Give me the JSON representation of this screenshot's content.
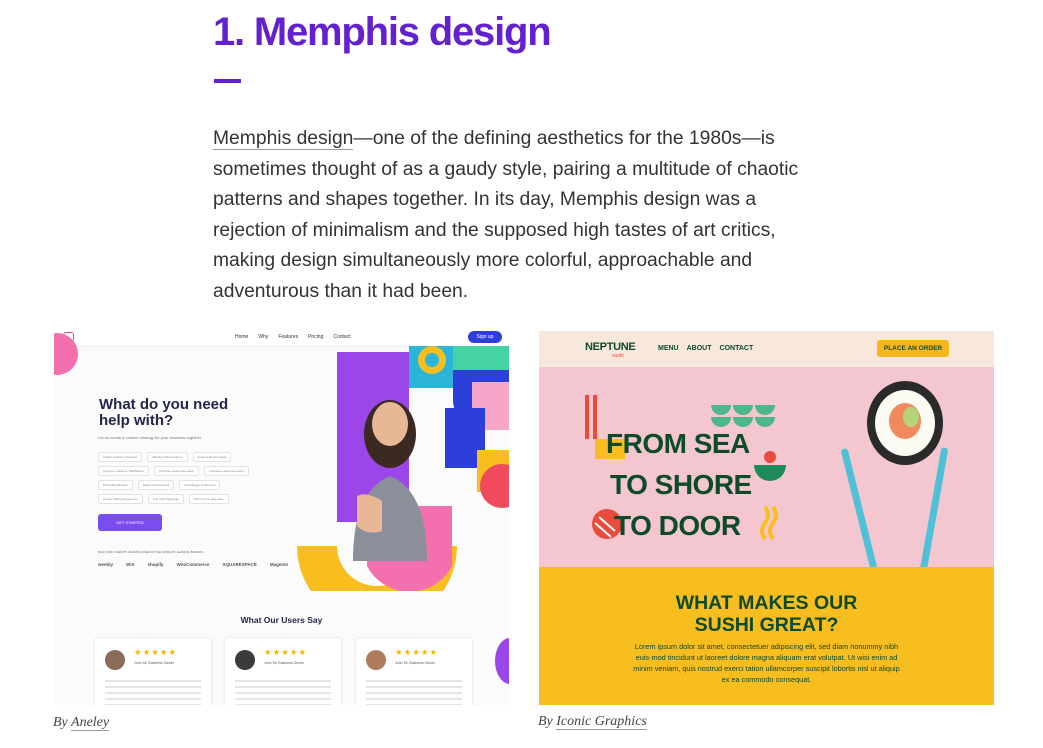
{
  "article": {
    "title": "1. Memphis design",
    "link_text": "Memphis design",
    "body_text": "—one of the defining aesthetics for the 1980s—is sometimes thought of as a gaudy style, pairing a multitude of chaotic patterns and shapes together. In its day, Memphis design was a rejection of minimalism and the supposed high tastes of art critics, making design simultaneously more colorful, approachable and adventurous than it had been."
  },
  "colors": {
    "accent_purple": "#6220d0",
    "neptune_green": "#0c4a2c",
    "neptune_yellow": "#f8bd1f",
    "neptune_pink": "#f4c6cf"
  },
  "figures": [
    {
      "caption_prefix": "By",
      "caption_author": "Aneley",
      "screenshot": {
        "nav_links": [
          "Home",
          "Why",
          "Features",
          "Pricing",
          "Contact"
        ],
        "signup_label": "Sign up",
        "heading": "What do you need help with?",
        "subheading": "Let us create a custom strategy for your business together",
        "options": [
          "Instant Customer Support",
          "Filtering Sales Support",
          "Improve Brand Image",
          "Improve Customer Satisfaction",
          "Incentive Lead Generation",
          "Incentive Lead Generation",
          "Promoting Brokers",
          "Higher Conversions",
          "Goal Bigger Customers",
          "Create Selling Experience",
          "Lost Cart Paybacks",
          "Sell more & easy save"
        ],
        "cta_label": "GET STARTED",
        "trusted_text": "BUILT AND USED BY 40 EMPLOYEES IN THE WORLDS' LEADING BRANDS",
        "brands": [
          "weebly",
          "WiX",
          "shopify",
          "WooCommerce",
          "SQUARESPACE",
          "Magento"
        ],
        "testimonials_title": "What Our Users Say",
        "testimonials": [
          {
            "stars": "★★★★★",
            "name": "John Sil, Business Owner"
          },
          {
            "stars": "★★★★★",
            "name": "John Sil, Business Owner"
          },
          {
            "stars": "★★★★★",
            "name": "John Sil, Business Owner"
          }
        ]
      }
    },
    {
      "caption_prefix": "By",
      "caption_author": "Iconic Graphics",
      "screenshot": {
        "logo": "NEPTUNE",
        "logo_sub": "sushi",
        "menu": [
          "MENU",
          "ABOUT",
          "CONTACT"
        ],
        "order_label": "PLACE AN ORDER",
        "hero_lines": [
          "FROM SEA",
          "TO SHORE",
          "TO DOOR"
        ],
        "section_heading_1": "WHAT MAKES OUR",
        "section_heading_2": "SUSHI GREAT?",
        "section_text": "Lorem ipsum dolor sit amet, consectetuer adipiscing elit, sed diam nonummy nibh euis-mod tincidunt ut laoreet dolore magna aliquam erat volutpat. Ut wisi enim ad minim veniam, quis nostrud exerci tation ullamcorper suscipit lobortis nisl ut aliquip ex ea commodo consequat."
      }
    }
  ]
}
